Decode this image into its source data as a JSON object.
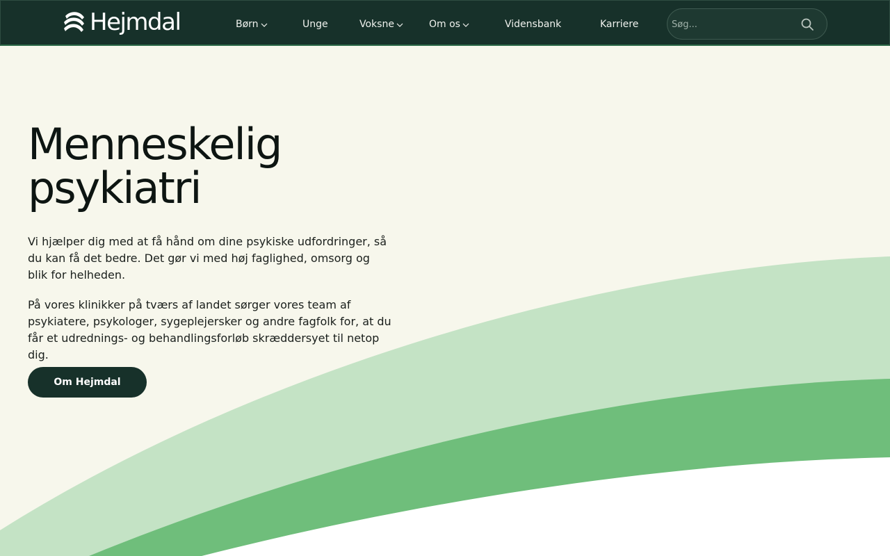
{
  "header": {
    "logo_text": "Hejmdal",
    "nav": [
      {
        "label": "Børn",
        "has_dropdown": true
      },
      {
        "label": "Unge",
        "has_dropdown": false
      },
      {
        "label": "Voksne",
        "has_dropdown": true
      },
      {
        "label": "Om os",
        "has_dropdown": true
      },
      {
        "label": "Vidensbank",
        "has_dropdown": false
      },
      {
        "label": "Karriere",
        "has_dropdown": false
      }
    ],
    "search": {
      "placeholder": "Søg...",
      "value": ""
    }
  },
  "hero": {
    "title_line1": "Menneskelig",
    "title_line2": "psykiatri",
    "paragraph1": "Vi hjælper dig med at få hånd om dine psykiske udfordringer, så du kan få det bedre. Det gør vi med høj faglighed, omsorg og blik for helheden.",
    "paragraph2": "På vores klinikker på tværs af landet sørger vores team af psykiatere, psykologer, sygeplejersker og andre fagfolk for, at du får et udrednings- og behandlingsforløb skræddersyet til netop dig.",
    "cta_label": "Om Hejmdal"
  },
  "colors": {
    "header_bg": "#17312a",
    "page_bg": "#f7f7ec",
    "wave_light": "#c4e3c5",
    "wave_mid": "#6fbe7b",
    "cta_bg": "#17312a"
  },
  "icons": {
    "logo": "hejmdal-logo-icon",
    "dropdown": "chevron-down-icon",
    "search": "search-icon"
  }
}
